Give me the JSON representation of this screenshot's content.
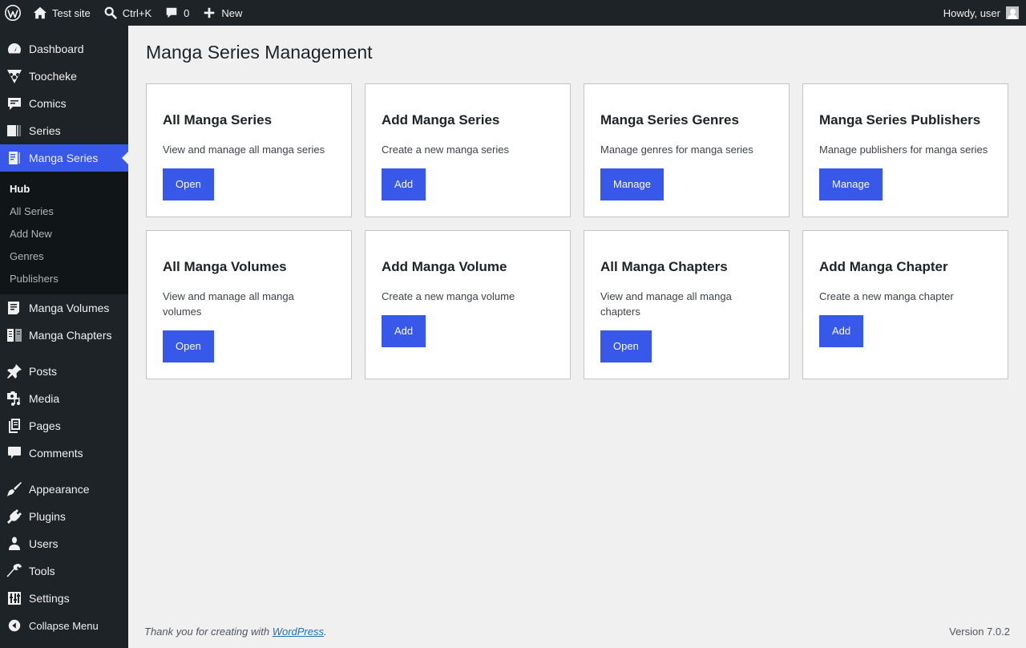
{
  "adminbar": {
    "site_name": "Test site",
    "search_shortcut": "Ctrl+K",
    "comments_count": "0",
    "new_label": "New",
    "howdy": "Howdy, user"
  },
  "sidebar": {
    "items_top": [
      {
        "label": "Dashboard",
        "icon": "dashboard-icon"
      },
      {
        "label": "Toocheke",
        "icon": "toocheke-icon"
      },
      {
        "label": "Comics",
        "icon": "comics-icon"
      },
      {
        "label": "Series",
        "icon": "series-icon"
      },
      {
        "label": "Manga Series",
        "icon": "manga-series-icon"
      }
    ],
    "submenu": [
      "Hub",
      "All Series",
      "Add New",
      "Genres",
      "Publishers"
    ],
    "items_mid": [
      {
        "label": "Manga Volumes",
        "icon": "manga-volumes-icon"
      },
      {
        "label": "Manga Chapters",
        "icon": "manga-chapters-icon"
      }
    ],
    "items_content": [
      {
        "label": "Posts",
        "icon": "pin-icon"
      },
      {
        "label": "Media",
        "icon": "media-icon"
      },
      {
        "label": "Pages",
        "icon": "pages-icon"
      },
      {
        "label": "Comments",
        "icon": "comment-icon"
      }
    ],
    "items_admin": [
      {
        "label": "Appearance",
        "icon": "brush-icon"
      },
      {
        "label": "Plugins",
        "icon": "plug-icon"
      },
      {
        "label": "Users",
        "icon": "users-icon"
      },
      {
        "label": "Tools",
        "icon": "wrench-icon"
      },
      {
        "label": "Settings",
        "icon": "settings-icon"
      }
    ],
    "collapse_label": "Collapse Menu"
  },
  "main": {
    "title": "Manga Series Management",
    "cards": [
      {
        "title": "All Manga Series",
        "desc": "View and manage all manga series",
        "button": "Open"
      },
      {
        "title": "Add Manga Series",
        "desc": "Create a new manga series",
        "button": "Add"
      },
      {
        "title": "Manga Series Genres",
        "desc": "Manage genres for manga series",
        "button": "Manage"
      },
      {
        "title": "Manga Series Publishers",
        "desc": "Manage publishers for manga series",
        "button": "Manage"
      },
      {
        "title": "All Manga Volumes",
        "desc": "View and manage all manga volumes",
        "button": "Open"
      },
      {
        "title": "Add Manga Volume",
        "desc": "Create a new manga volume",
        "button": "Add"
      },
      {
        "title": "All Manga Chapters",
        "desc": "View and manage all manga chapters",
        "button": "Open"
      },
      {
        "title": "Add Manga Chapter",
        "desc": "Create a new manga chapter",
        "button": "Add"
      }
    ]
  },
  "footer": {
    "thanks_prefix": "Thank you for creating with ",
    "thanks_link": "WordPress",
    "thanks_suffix": ".",
    "version": "Version 7.0.2"
  },
  "colors": {
    "accent": "#3858e9",
    "chrome": "#1d2327",
    "background": "#f0f0f1"
  }
}
